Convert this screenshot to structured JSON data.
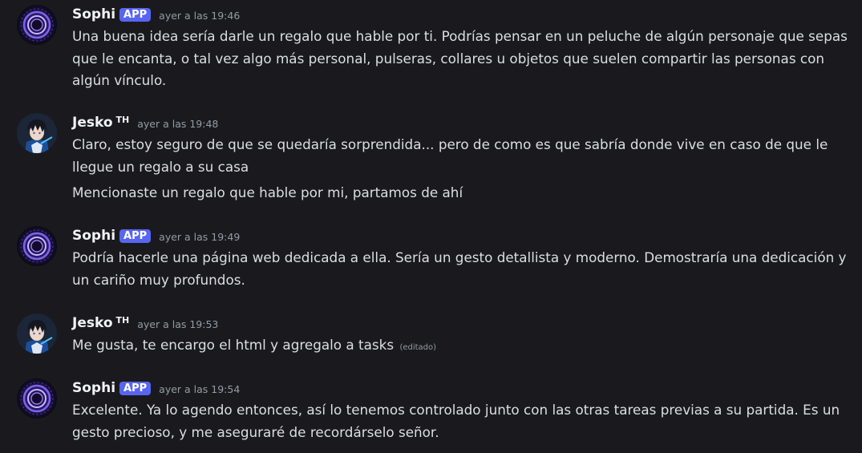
{
  "messages": [
    {
      "author": "Sophi",
      "badge": "APP",
      "timestamp": "ayer a las 19:46",
      "lines": [
        "Una buena idea sería darle un regalo que hable por ti. Podrías pensar en un peluche de algún personaje que sepas que le encanta, o tal vez algo más personal, pulseras, collares u objetos que suelen compartir las personas con algún vínculo."
      ]
    },
    {
      "author": "Jesko",
      "tag": "TH",
      "timestamp": "ayer a las 19:48",
      "lines": [
        "Claro, estoy seguro de que se quedaría sorprendida... pero de como es que sabría donde vive en caso de que le llegue un regalo a su casa",
        "Mencionaste un regalo que hable por mi, partamos de ahí"
      ]
    },
    {
      "author": "Sophi",
      "badge": "APP",
      "timestamp": "ayer a las 19:49",
      "lines": [
        "Podría hacerle una página web dedicada a ella. Sería un gesto detallista y moderno. Demostraría una dedicación y un cariño muy profundos."
      ]
    },
    {
      "author": "Jesko",
      "tag": "TH",
      "timestamp": "ayer a las 19:53",
      "lines": [
        "Me gusta, te encargo el html y agregalo a tasks"
      ],
      "edited": "(editado)"
    },
    {
      "author": "Sophi",
      "badge": "APP",
      "timestamp": "ayer a las 19:54",
      "lines": [
        "Excelente. Ya lo agendo entonces, así lo tenemos controlado junto con las otras tareas previas a su partida. Es un gesto precioso, y me aseguraré de recordárselo señor."
      ]
    }
  ],
  "colors": {
    "background": "#1a1a1e",
    "username": "#f2f3f5",
    "message_text": "#dbdee1",
    "timestamp": "#949ba4",
    "app_badge": "#5865f2"
  },
  "icons": {
    "sophi_avatar": "purple-portal-avatar-icon",
    "jesko_avatar": "anime-character-avatar-icon"
  }
}
